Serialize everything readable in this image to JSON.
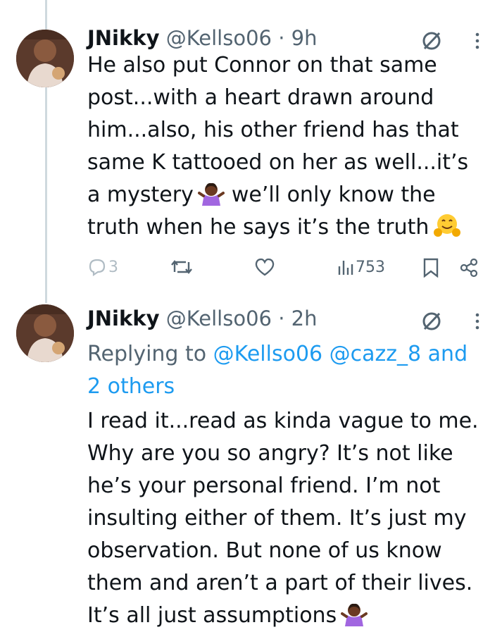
{
  "tweets": [
    {
      "name": "JNikky",
      "handle": "@Kellso06",
      "dot": "·",
      "time": "9h",
      "lines": [
        "He also put Connor on that same",
        "post...with a heart drawn around",
        "him...also, his other friend has that",
        "same K tattooed on her as well...it’s",
        "a mystery",
        "we’ll only know the",
        "truth when he says it’s the truth"
      ],
      "emojis": [
        "shrug-woman-emoji",
        "hugging-face-emoji"
      ],
      "actions": {
        "replies": "3",
        "retweets": "",
        "likes": "",
        "views": "753"
      }
    },
    {
      "name": "JNikky",
      "handle": "@Kellso06",
      "dot": "·",
      "time": "2h",
      "replying_prefix": "Replying to ",
      "replying_mentions": "@Kellso06 @cazz_8 and",
      "replying_others": "2 others",
      "lines": [
        "I read it...read as kinda vague to me.",
        "Why are you so angry? It’s not like",
        "he’s your personal friend. I’m not",
        "insulting either of them. It’s just my",
        "observation. But none of us know",
        "them and aren’t a part of their lives.",
        "It’s all just assumptions"
      ],
      "emojis": [
        "shrug-woman-emoji"
      ]
    }
  ],
  "icons": [
    "reply-icon",
    "retweet-icon",
    "like-icon",
    "views-icon",
    "bookmark-icon",
    "share-icon",
    "grok-icon",
    "more-icon"
  ],
  "colors": {
    "text": "#0f1419",
    "secondary": "#536471",
    "link": "#1d9bf0",
    "thread": "#cfd9de"
  }
}
